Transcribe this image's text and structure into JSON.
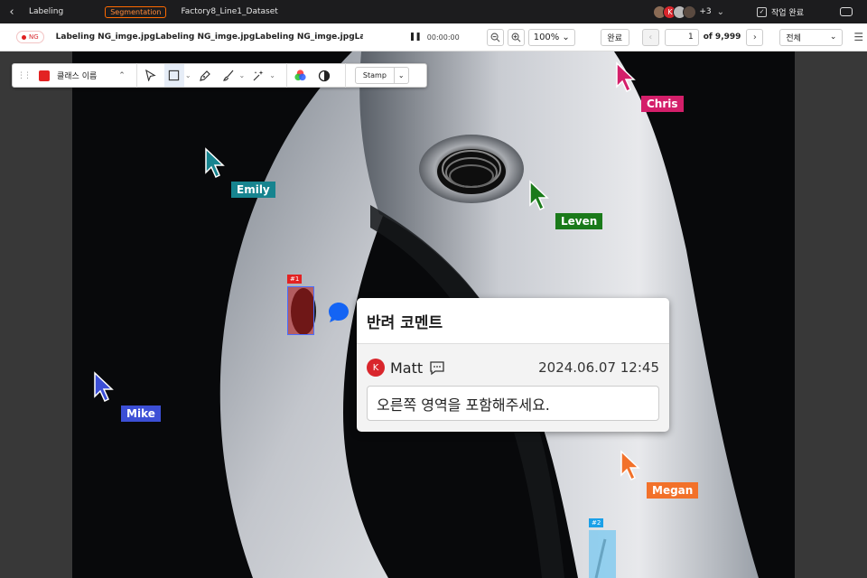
{
  "topbar": {
    "crumb": "Labeling",
    "mode_badge": "Segmentation",
    "dataset": "Factory8_Line1_Dataset",
    "avatar_letter": "K",
    "extra_count": "+3",
    "complete_label": "작업 완료"
  },
  "subbar": {
    "ng_label": "NG",
    "file_name": "Labeling NG_imge.jpgLabeling NG_imge.jpgLabeling NG_imge.jpgLabeling NG...",
    "timer": "00:00:00",
    "zoom": "100%",
    "done_label": "완료",
    "page_current": "1",
    "page_total": "of 9,999",
    "filter": "전체"
  },
  "toolbar": {
    "class_name": "클래스 이름",
    "class_color": "#e32222",
    "stamp_label": "Stamp"
  },
  "users": [
    {
      "name": "Chris",
      "color": "#d41f6a"
    },
    {
      "name": "Emily",
      "color": "#17848f"
    },
    {
      "name": "Leven",
      "color": "#1a7a1a"
    },
    {
      "name": "Mike",
      "color": "#3c4fd6"
    },
    {
      "name": "Megan",
      "color": "#f2712a"
    }
  ],
  "annotations": [
    {
      "tag": "#1",
      "color": "#e32222"
    },
    {
      "tag": "#2",
      "color": "#1ba0e8"
    }
  ],
  "comment": {
    "title": "반려 코멘트",
    "author_initial": "K",
    "author": "Matt",
    "date": "2024.06.07 12:45",
    "text": "오른쪽 영역을 포함해주세요."
  }
}
